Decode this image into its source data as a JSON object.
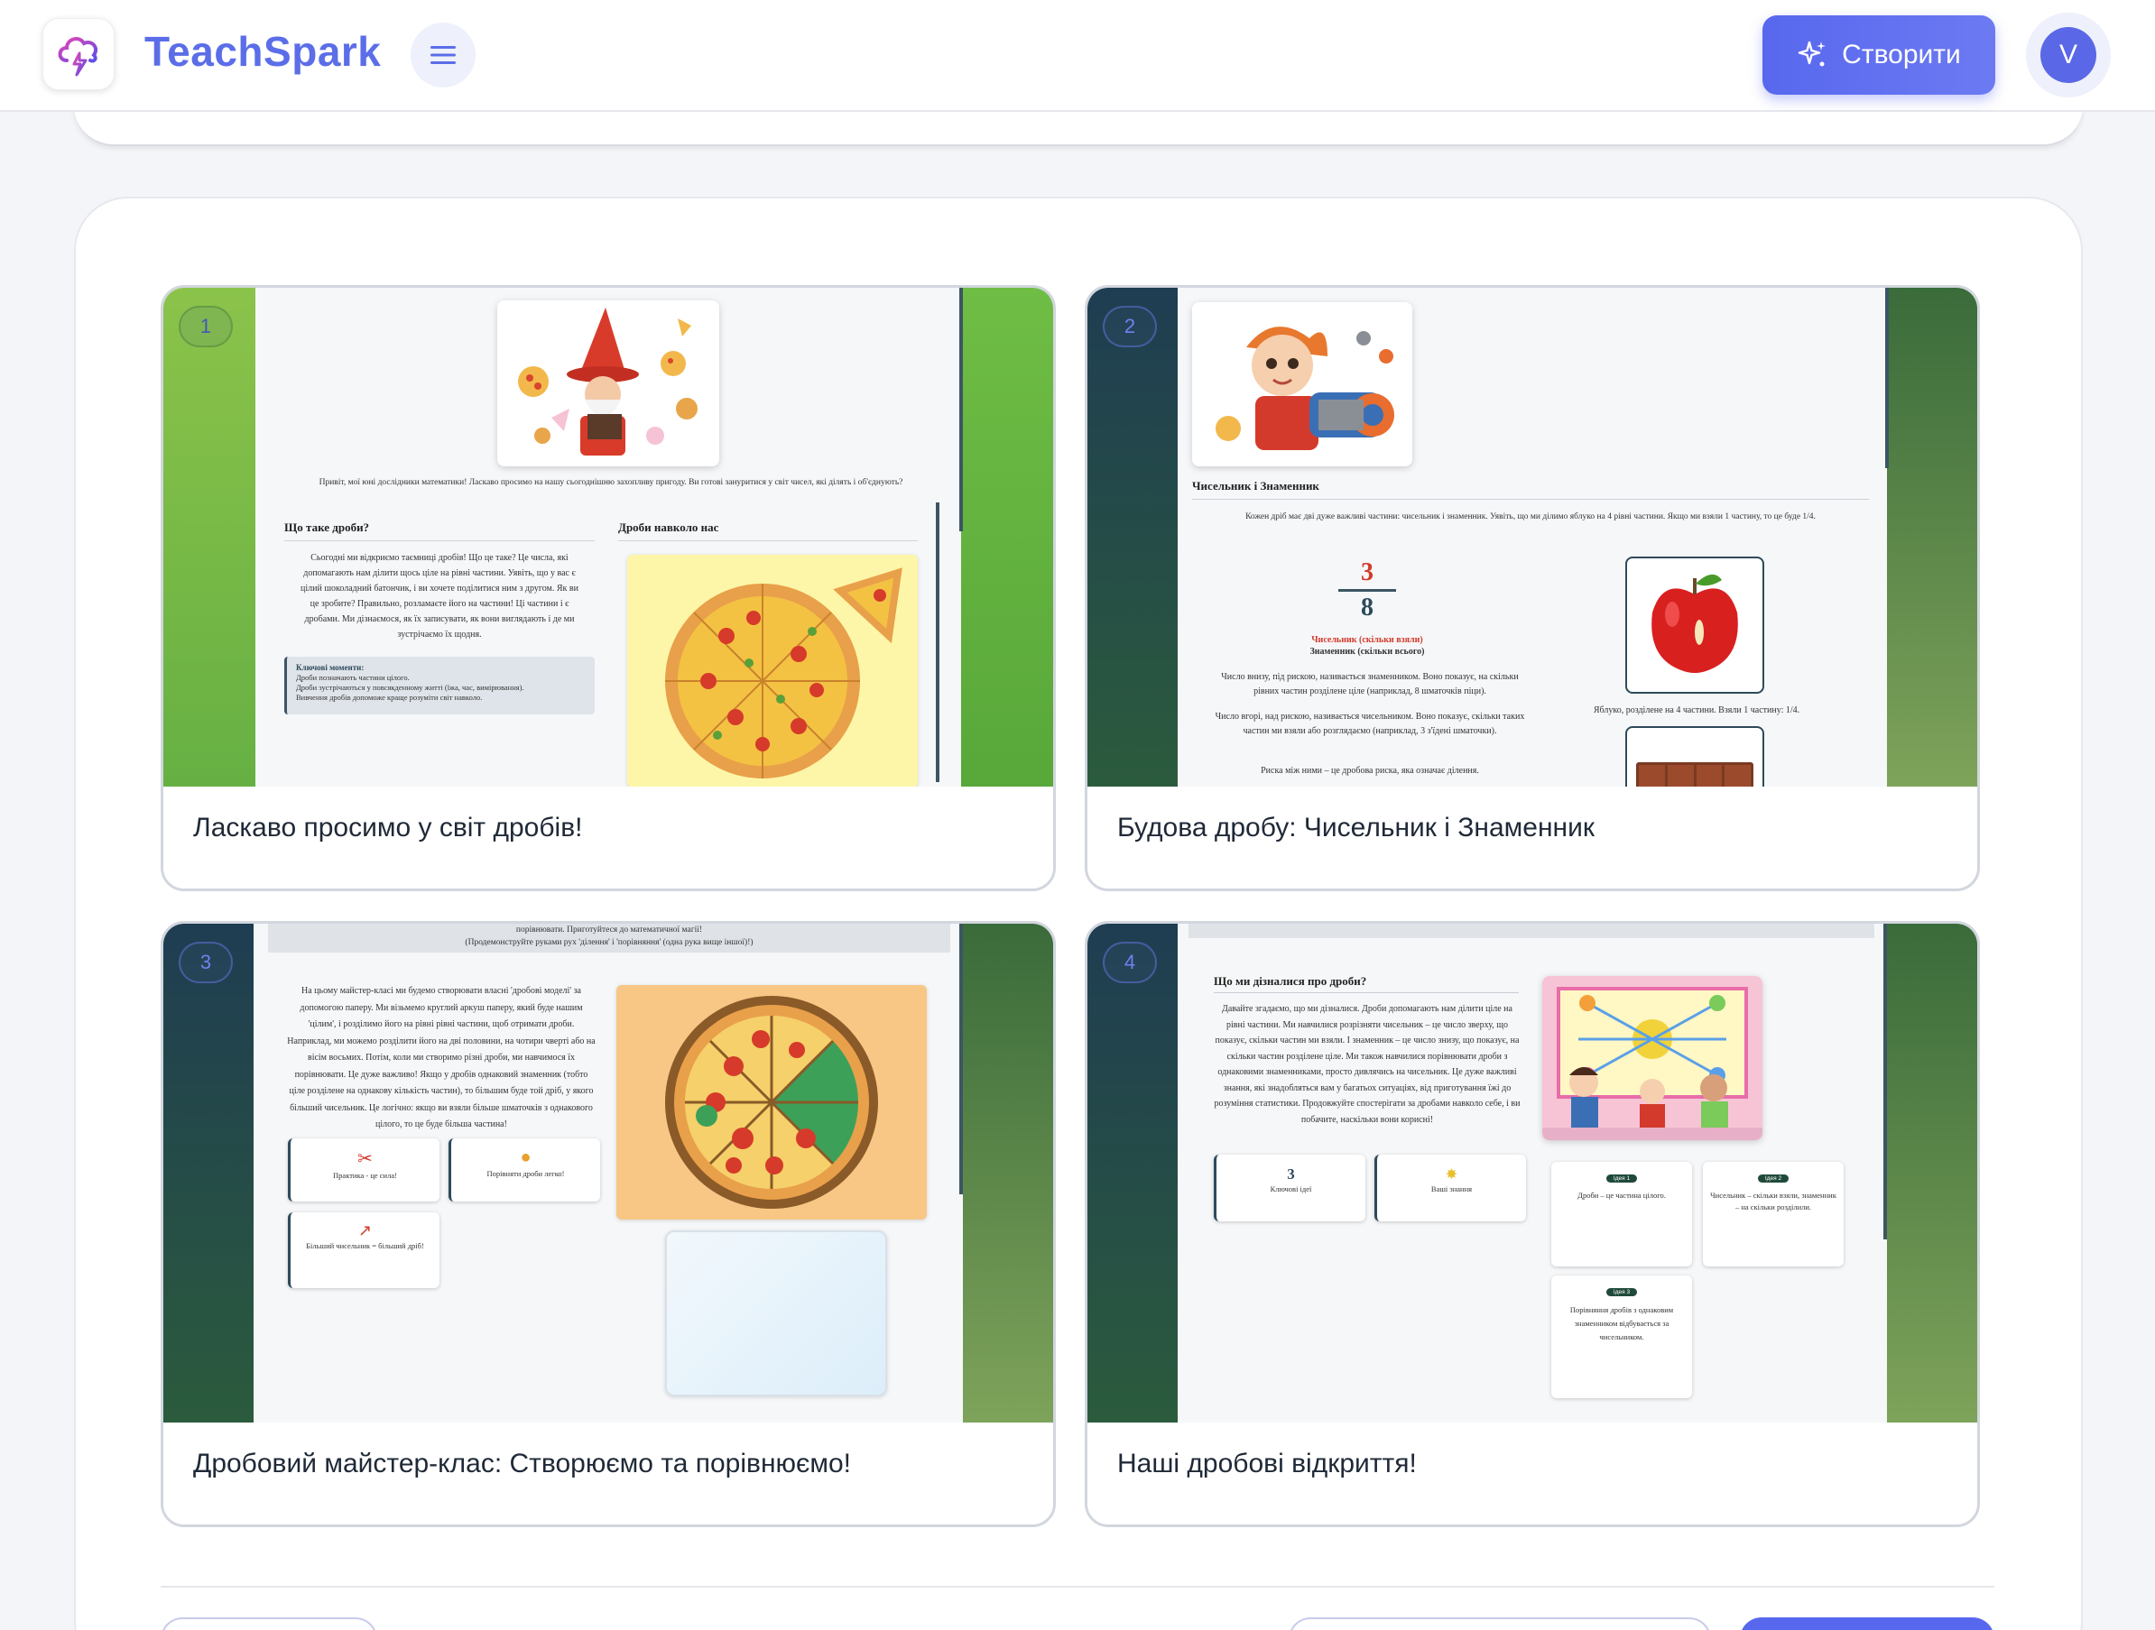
{
  "header": {
    "brand": "TeachSpark",
    "create_label": "Створити",
    "avatar_initial": "V"
  },
  "slides": [
    {
      "number": "1",
      "title": "Ласкаво просимо у світ дробів!",
      "intro": "Привіт, мої юні дослідники математики! Ласкаво просимо на нашу сьогоднішню захопливу пригоду. Ви готові зануритися у світ чисел, які ділять і об'єднують?",
      "left_heading": "Що таке дроби?",
      "left_text": "Сьогодні ми відкриємо таємниці дробів! Що це таке? Це числа, які допомагають нам ділити щось ціле на рівні частини. Уявіть, що у вас є цілий шоколадний батончик, і ви хочете поділитися ним з другом. Як ви це зробите? Правильно, розламаєте його на частини! Ці частини і є дробами. Ми дізнаємося, як їх записувати, як вони виглядають і де ми зустрічаємо їх щодня.",
      "key_title": "Ключові моменти:",
      "key_points": [
        "Дроби позначають частини цілого.",
        "Дроби зустрічаються у повсякденному житті (їжа, час, вимірювання).",
        "Вивчення дробів допоможе краще розуміти світ навколо."
      ],
      "right_heading": "Дроби навколо нас"
    },
    {
      "number": "2",
      "title": "Будова дробу: Чисельник і Знаменник",
      "heading": "Чисельник і Знаменник",
      "intro": "Кожен дріб має дві дуже важливі частини: чисельник і знаменник. Уявіть, що ми ділимо яблуко на 4 рівні частини. Якщо ми взяли 1 частину, то це буде 1/4.",
      "numerator": "3",
      "denominator": "8",
      "legend_num": "Чисельник (скільки взяли)",
      "legend_den": "Знаменник (скільки всього)",
      "p1": "Число внизу, під рискою, називається знаменником. Воно показує, на скільки рівних частин розділене ціле (наприклад, 8 шматочків піци).",
      "p2": "Число вгорі, над рискою, називається чисельником. Воно показує, скільки таких частин ми взяли або розглядаємо (наприклад, 3 з'їдені шматочки).",
      "p3": "Риска між ними – це дробова риска, яка означає ділення.",
      "apple_caption": "Яблуко, розділене на 4 частини. Взяли 1 частину: 1/4."
    },
    {
      "number": "3",
      "title": "Дробовий майстер-клас: Створюємо та порівнюємо!",
      "top_line1": "порівнювати. Приготуйтеся до математичної магії!",
      "top_line2": "(Продемонструйте руками рух 'ділення' і 'порівняння' (одна рука вище іншої)!)",
      "body": "На цьому майстер-класі ми будемо створювати власні 'дробові моделі' за допомогою паперу. Ми візьмемо круглий аркуш паперу, який буде нашим 'цілим', і розділимо його на рівні рівні частини, щоб отримати дроби. Наприклад, ми можемо розділити його на дві половини, на чотири чверті або на вісім восьмих. Потім, коли ми створимо різні дроби, ми навчимося їх порівнювати. Це дуже важливо! Якщо у дробів однаковий знаменник (тобто ціле розділене на однакову кількість частин), то більшим буде той дріб, у якого більший чисельник. Це логічно: якщо ви взяли більше шматочків з однакового цілого, то це буде більша частина!",
      "tile1": "Практика - це сила!",
      "tile2": "Порівняти дроби легко!",
      "tile3": "Більший чисельник = більший дріб!"
    },
    {
      "number": "4",
      "title": "Наші дробові відкриття!",
      "heading": "Що ми дізналися про дроби?",
      "body": "Давайте згадаємо, що ми дізналися. Дроби допомагають нам ділити ціле на рівні частини. Ми навчилися розрізняти чисельник – це число зверху, що показує, скільки частин ми взяли. І знаменник – це число знизу, що показує, на скільки частин розділене ціле. Ми також навчилися порівнювати дроби з однаковими знаменниками, просто дивлячись на чисельник. Це дуже важливі знання, які знадобляться вам у багатьох ситуаціях, від приготування їжі до розуміння статистики. Продовжуйте спостерігати за дробами навколо себе, і ви побачите, наскільки вони корисні!",
      "stat_value": "3",
      "stat_label": "Ключові ідеї",
      "stat2_label": "Ваші знання",
      "idea1_tag": "Ідея 1",
      "idea1": "Дроби – це частина цілого.",
      "idea2_tag": "Ідея 2",
      "idea2": "Чисельник – скільки взяли, знаменник – на скільки розділили.",
      "idea3_tag": "Ідея 3",
      "idea3": "Порівняння дробів з однаковим знаменником відбувається за чисельником."
    }
  ]
}
